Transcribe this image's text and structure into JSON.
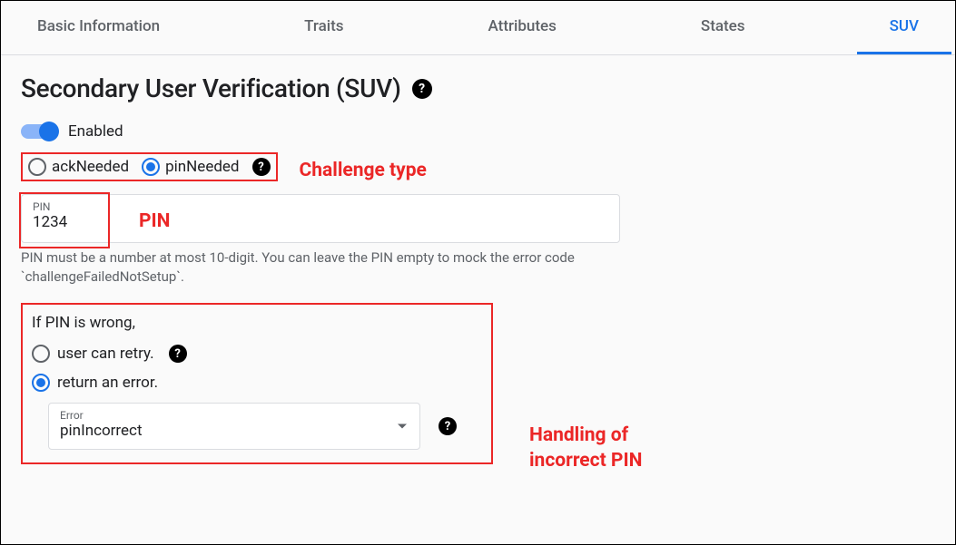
{
  "tabs": {
    "basic": "Basic Information",
    "traits": "Traits",
    "attributes": "Attributes",
    "states": "States",
    "suv": "SUV"
  },
  "heading": "Secondary User Verification (SUV)",
  "toggle": {
    "label": "Enabled",
    "on": true
  },
  "challenge": {
    "ackNeeded": "ackNeeded",
    "pinNeeded": "pinNeeded",
    "selected": "pinNeeded"
  },
  "annotations": {
    "challenge": "Challenge type",
    "pin": "PIN",
    "error": "Handling of\nincorrect PIN"
  },
  "pinField": {
    "label": "PIN",
    "value": "1234",
    "helper": "PIN must be a number at most 10-digit. You can leave the PIN empty to mock the error code `challengeFailedNotSetup`."
  },
  "errorSection": {
    "prompt": "If PIN is wrong,",
    "retry": "user can retry.",
    "returnError": "return an error.",
    "selected": "returnError",
    "select": {
      "label": "Error",
      "value": "pinIncorrect"
    }
  }
}
